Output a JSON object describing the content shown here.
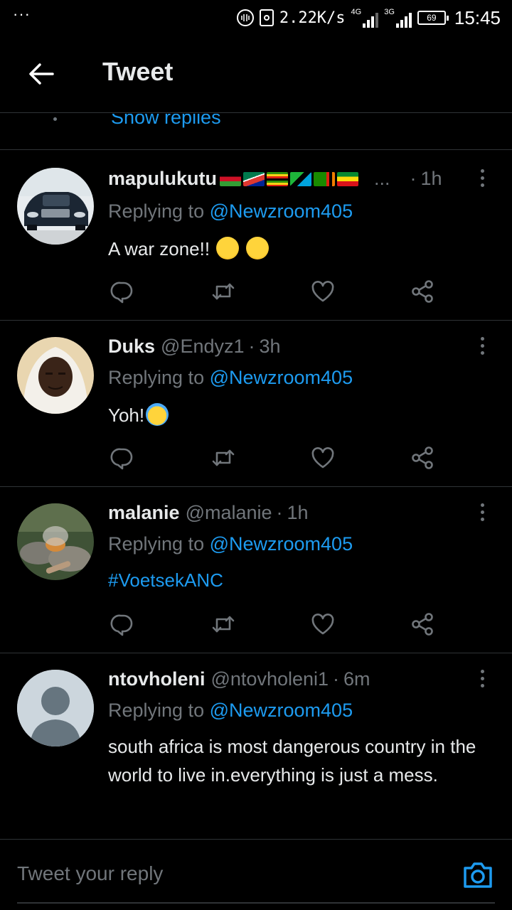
{
  "status_bar": {
    "dots": "···",
    "speed": "2.22K/s",
    "net1": "4G",
    "net2": "3G",
    "battery": "69",
    "time": "15:45"
  },
  "header": {
    "title": "Tweet"
  },
  "show_replies": "Show replies",
  "tweets": [
    {
      "name": "mapulukutu",
      "handle": "",
      "ellipsis": "...",
      "time": "1h",
      "replying_prefix": "Replying to ",
      "mention": "@Newzroom405",
      "text": "A war zone!!",
      "emojis": [
        "thinking-face",
        "thinking-face"
      ]
    },
    {
      "name": "Duks",
      "handle": "@Endyz1",
      "time": "3h",
      "replying_prefix": "Replying to ",
      "mention": "@Newzroom405",
      "text": "Yoh!",
      "emojis": [
        "screaming-face"
      ]
    },
    {
      "name": "malanie",
      "handle": "@malanie",
      "time": "1h",
      "replying_prefix": "Replying to ",
      "mention": "@Newzroom405",
      "text": "#VoetsekANC"
    },
    {
      "name": "ntovholeni",
      "handle": "@ntovholeni1",
      "time": "6m",
      "replying_prefix": "Replying to ",
      "mention": "@Newzroom405",
      "text": "south africa is most dangerous country in the world to live in.everything is just a mess."
    }
  ],
  "reply_bar": {
    "placeholder": "Tweet your reply"
  },
  "colors": {
    "accent": "#1d9bf0",
    "muted": "#71767b",
    "background": "#000000",
    "text": "#e7e9ea"
  }
}
